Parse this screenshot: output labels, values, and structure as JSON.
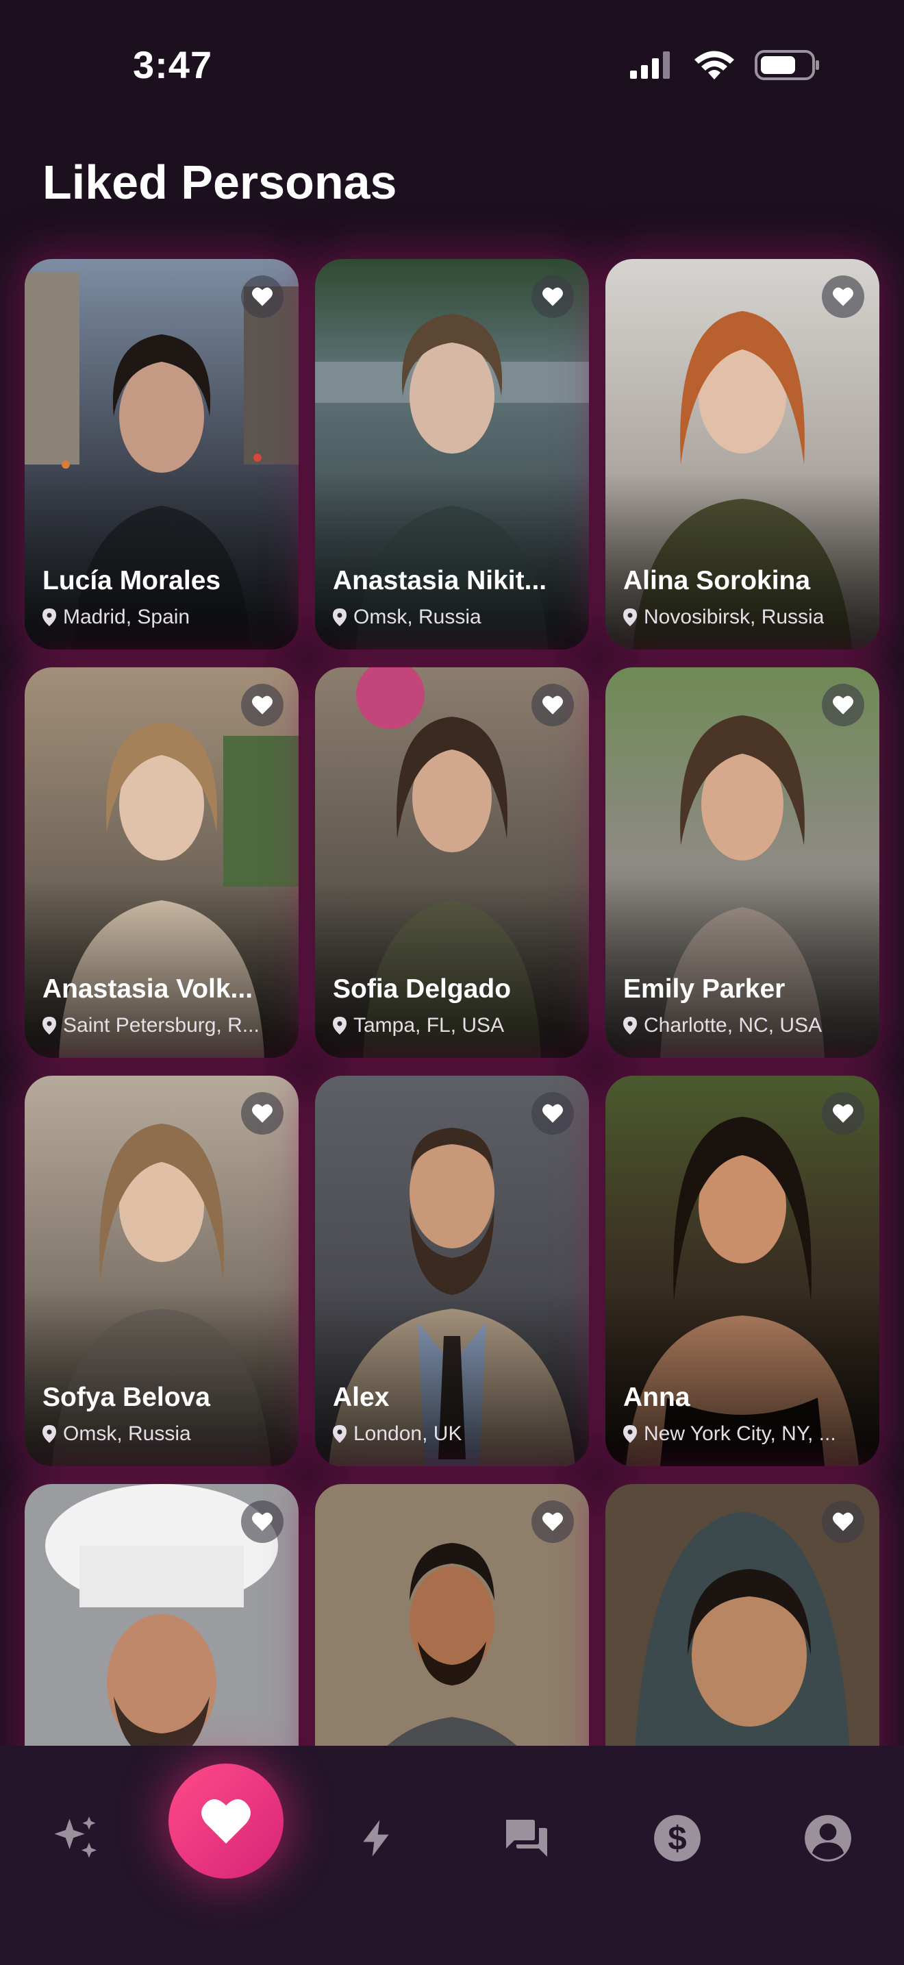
{
  "status_bar": {
    "time": "3:47"
  },
  "page": {
    "title": "Liked Personas"
  },
  "personas": [
    {
      "name": "Lucía Morales",
      "location": "Madrid, Spain"
    },
    {
      "name": "Anastasia Nikit...",
      "location": "Omsk, Russia"
    },
    {
      "name": "Alina Sorokina",
      "location": "Novosibirsk, Russia"
    },
    {
      "name": "Anastasia Volk...",
      "location": "Saint Petersburg, R..."
    },
    {
      "name": "Sofia Delgado",
      "location": "Tampa, FL, USA"
    },
    {
      "name": "Emily Parker",
      "location": "Charlotte, NC, USA"
    },
    {
      "name": "Sofya Belova",
      "location": "Omsk, Russia"
    },
    {
      "name": "Alex",
      "location": "London, UK"
    },
    {
      "name": "Anna",
      "location": "New York City, NY, ..."
    }
  ],
  "tabs": [
    {
      "icon": "sparkles-icon"
    },
    {
      "icon": "heart-icon",
      "active": true
    },
    {
      "icon": "bolt-icon"
    },
    {
      "icon": "chat-icon"
    },
    {
      "icon": "dollar-icon"
    },
    {
      "icon": "profile-icon"
    }
  ],
  "colors": {
    "background": "#1c0f1e",
    "accent": "#ff4b88",
    "tab_bar": "#24152a"
  }
}
